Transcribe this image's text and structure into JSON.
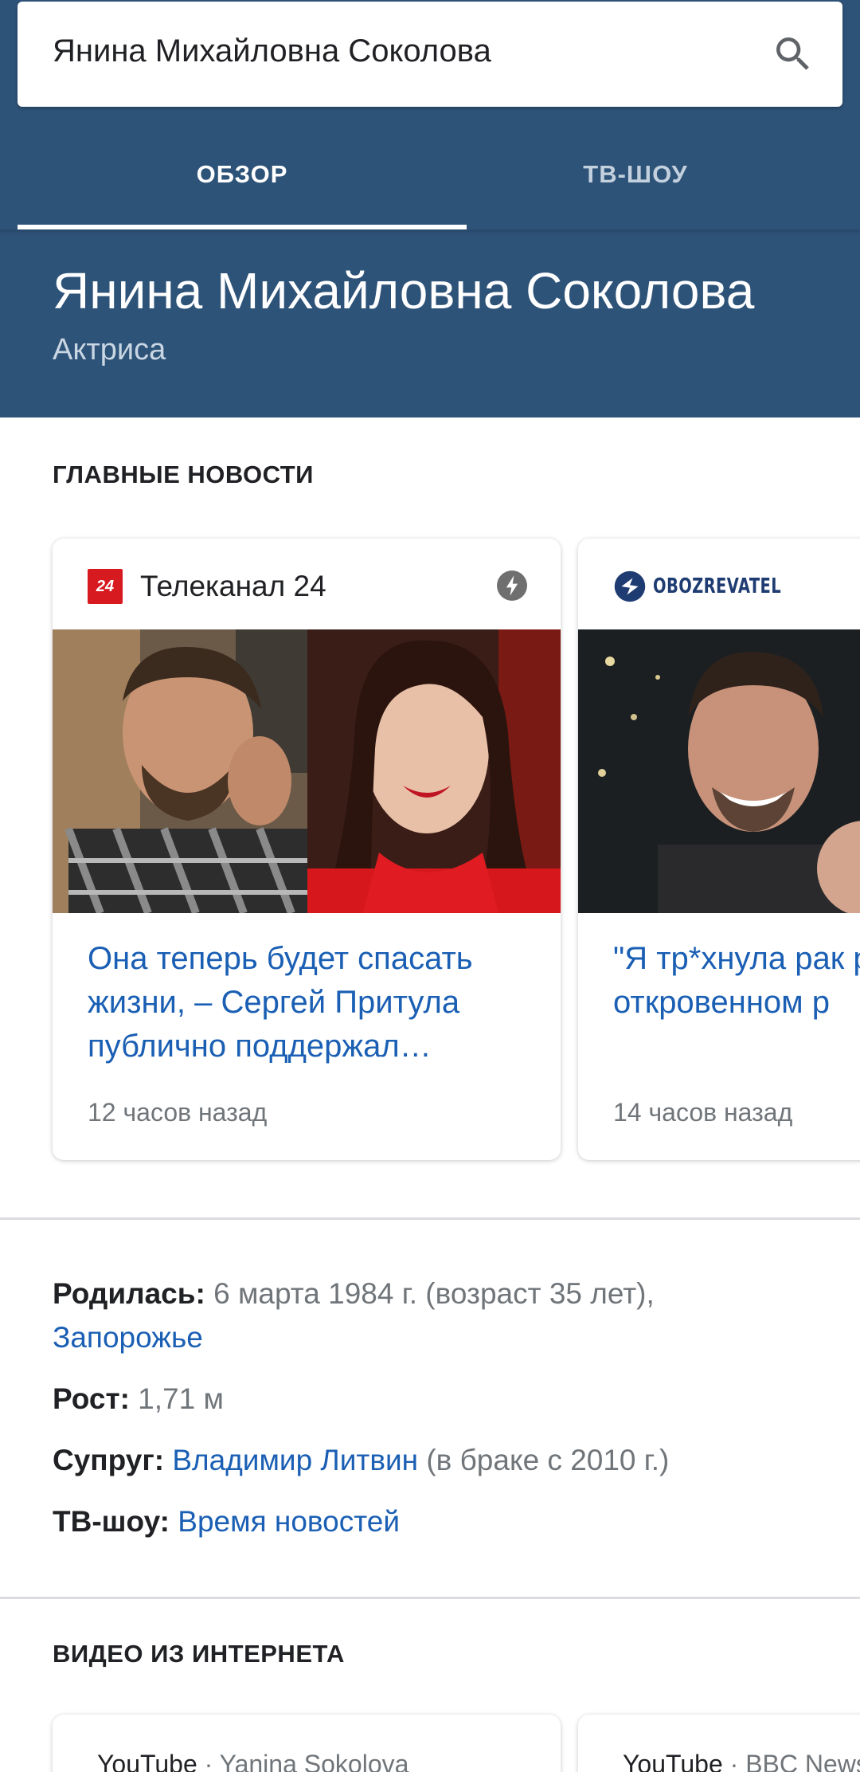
{
  "search": {
    "query": "Янина Михайловна Соколова"
  },
  "tabs": [
    {
      "label": "ОБЗОР",
      "selected": true
    },
    {
      "label": "ТВ-ШОУ",
      "selected": false
    }
  ],
  "entity": {
    "name": "Янина Михайловна Соколова",
    "description": "Актриса"
  },
  "top_news": {
    "heading": "ГЛАВНЫЕ НОВОСТИ",
    "cards": [
      {
        "source": "Телеканал 24",
        "source_logo_text": "24",
        "headline": "Она теперь будет спасать жизни, – Сергей Притула публично поддержал…",
        "time": "12 часов назад",
        "has_amp_icon": true
      },
      {
        "source": "OBOZREVATEL",
        "headline": "\"Я тр*хнула рак рассказал об откровенном р",
        "time": "14 часов назад"
      }
    ]
  },
  "facts": {
    "born_label": "Родилась:",
    "born_value": "6 марта 1984 г. (возраст 35 лет),",
    "born_place": "Запорожье",
    "height_label": "Рост:",
    "height_value": "1,71 м",
    "spouse_label": "Супруг:",
    "spouse_name": "Владимир Литвин",
    "spouse_note": "(в браке с 2010 г.)",
    "tvshow_label": "ТВ-шоу:",
    "tvshow_value": "Время новостей"
  },
  "videos": {
    "heading": "ВИДЕО ИЗ ИНТЕРНЕТА",
    "cards": [
      {
        "platform": "YouTube",
        "separator": " · ",
        "channel": "Yanina Sokolova"
      },
      {
        "platform": "YouTube",
        "separator": " · ",
        "channel": "BBC News"
      }
    ]
  },
  "colors": {
    "header_bg": "#2e5378",
    "link": "#1a5fb4",
    "secondary_text": "#70757a",
    "channel_24_red": "#d71920"
  },
  "icons": [
    "search-icon",
    "amp-lightning-icon",
    "channel-24-logo",
    "obozrevatel-logo"
  ]
}
